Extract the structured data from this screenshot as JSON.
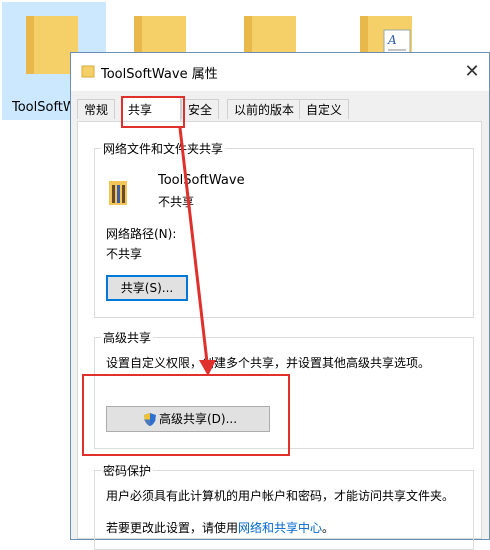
{
  "explorer": {
    "items": [
      {
        "label": "ToolSoftWave"
      },
      {
        "label": ""
      },
      {
        "label": ""
      },
      {
        "label": ""
      }
    ]
  },
  "dialog": {
    "title": "ToolSoftWave 属性",
    "close": "✕",
    "tabs": [
      {
        "label": "常规"
      },
      {
        "label": "共享"
      },
      {
        "label": "安全"
      },
      {
        "label": "以前的版本"
      },
      {
        "label": "自定义"
      }
    ],
    "network_share": {
      "group_title": "网络文件和文件夹共享",
      "item_name": "ToolSoftWave",
      "item_status": "不共享",
      "path_label": "网络路径(N):",
      "path_value": "不共享",
      "share_button": "共享(S)..."
    },
    "advanced_share": {
      "group_title": "高级共享",
      "description": "设置自定义权限，创建多个共享，并设置其他高级共享选项。",
      "button": "高级共享(D)..."
    },
    "password": {
      "group_title": "密码保护",
      "line1": "用户必须具有此计算机的用户帐户和密码，才能访问共享文件夹。",
      "line2_prefix": "若要更改此设置，请使用",
      "line2_link": "网络和共享中心",
      "line2_suffix": "。"
    }
  },
  "colors": {
    "annotation": "#e0302c",
    "accent": "#0078d7",
    "folder": "#f5c85a"
  }
}
